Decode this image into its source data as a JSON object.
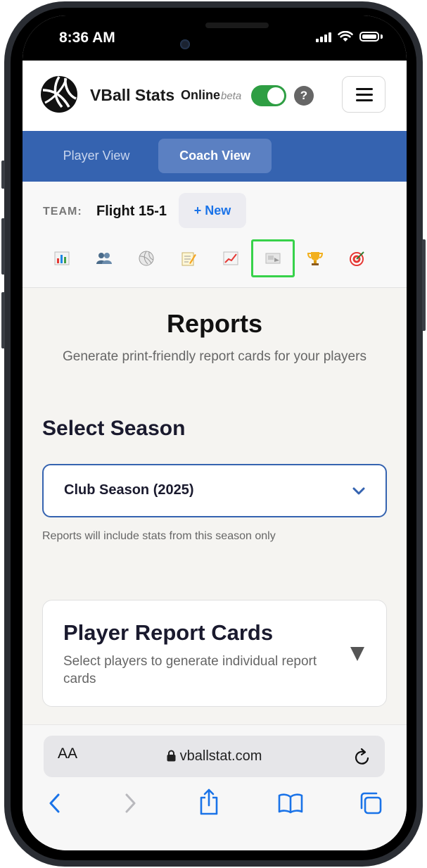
{
  "status_bar": {
    "time": "8:36 AM"
  },
  "header": {
    "brand": "VBall Stats",
    "online_label": "Online",
    "beta_label": "beta",
    "online_toggle": true,
    "help_label": "?"
  },
  "view_tabs": [
    {
      "label": "Player View",
      "active": false
    },
    {
      "label": "Coach View",
      "active": true
    }
  ],
  "team": {
    "label": "TEAM:",
    "name": "Flight 15-1",
    "new_button": "+ New"
  },
  "nav_icons": [
    {
      "name": "bar-chart-icon",
      "glyph": "📊",
      "active": false
    },
    {
      "name": "players-icon",
      "glyph": "👥",
      "active": false
    },
    {
      "name": "volleyball-icon",
      "glyph": "🏐",
      "active": false
    },
    {
      "name": "notes-icon",
      "glyph": "📝",
      "active": false
    },
    {
      "name": "trend-chart-icon",
      "glyph": "📈",
      "active": false
    },
    {
      "name": "report-card-icon",
      "glyph": "📇",
      "active": true
    },
    {
      "name": "trophy-icon",
      "glyph": "🏆",
      "active": false
    },
    {
      "name": "target-icon",
      "glyph": "🎯",
      "active": false
    }
  ],
  "reports": {
    "title": "Reports",
    "subtitle": "Generate print-friendly report cards for your players",
    "select_season_heading": "Select Season",
    "season_value": "Club Season (2025)",
    "season_hint": "Reports will include stats from this season only",
    "card_title": "Player Report Cards",
    "card_subtitle": "Select players to generate individual report cards"
  },
  "browser": {
    "aa_label": "AA",
    "url": "vballstat.com"
  },
  "colors": {
    "accent_blue": "#3563b0",
    "toggle_green": "#2e9e43",
    "active_icon_border": "#37d24a",
    "link_blue": "#1a73e8"
  }
}
